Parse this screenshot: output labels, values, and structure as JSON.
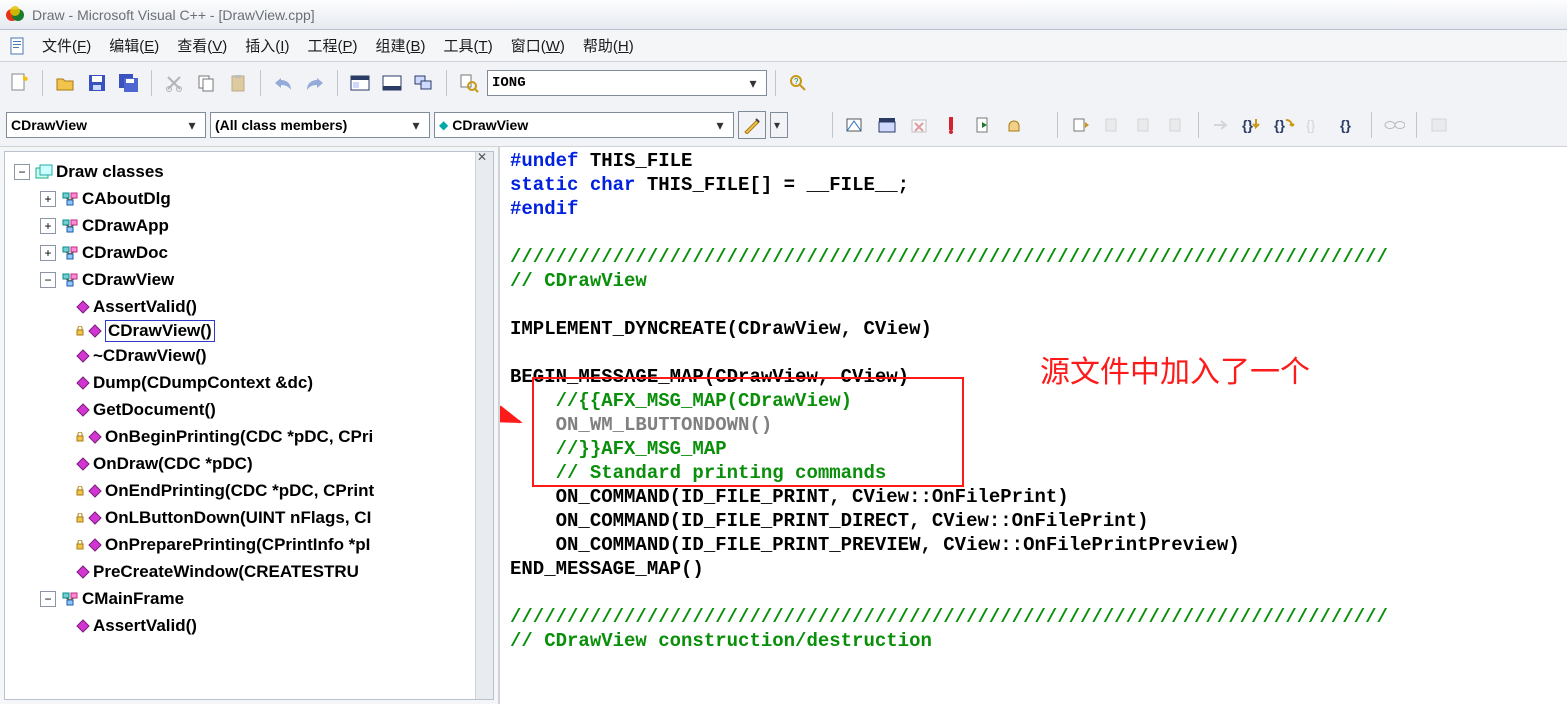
{
  "title": "Draw - Microsoft Visual C++ - [DrawView.cpp]",
  "menus": {
    "file": {
      "t": "文件",
      "k": "F"
    },
    "edit": {
      "t": "编辑",
      "k": "E"
    },
    "view": {
      "t": "查看",
      "k": "V"
    },
    "insert": {
      "t": "插入",
      "k": "I"
    },
    "project": {
      "t": "工程",
      "k": "P"
    },
    "build": {
      "t": "组建",
      "k": "B"
    },
    "tools": {
      "t": "工具",
      "k": "T"
    },
    "window": {
      "t": "窗口",
      "k": "W"
    },
    "help": {
      "t": "帮助",
      "k": "H"
    }
  },
  "toolbar1": {
    "search_value": "IONG"
  },
  "combos": {
    "class": "CDrawView",
    "filter": "(All class members)",
    "member": "CDrawView"
  },
  "tree": {
    "root": "Draw classes",
    "classes": [
      {
        "name": "CAboutDlg",
        "exp": "+"
      },
      {
        "name": "CDrawApp",
        "exp": "+"
      },
      {
        "name": "CDrawDoc",
        "exp": "+"
      },
      {
        "name": "CDrawView",
        "exp": "-",
        "members": [
          {
            "icon": "pub",
            "label": "AssertValid()"
          },
          {
            "icon": "prot",
            "label": "CDrawView()",
            "selected": true
          },
          {
            "icon": "pub",
            "label": "~CDrawView()"
          },
          {
            "icon": "pub",
            "label": "Dump(CDumpContext &dc)"
          },
          {
            "icon": "pub",
            "label": "GetDocument()"
          },
          {
            "icon": "prot",
            "label": "OnBeginPrinting(CDC *pDC, CPri"
          },
          {
            "icon": "pub",
            "label": "OnDraw(CDC *pDC)"
          },
          {
            "icon": "prot",
            "label": "OnEndPrinting(CDC *pDC, CPrint"
          },
          {
            "icon": "prot",
            "label": "OnLButtonDown(UINT nFlags, CI"
          },
          {
            "icon": "prot",
            "label": "OnPreparePrinting(CPrintInfo *pI"
          },
          {
            "icon": "pub",
            "label": "PreCreateWindow(CREATESTRU"
          }
        ]
      },
      {
        "name": "CMainFrame",
        "exp": "-",
        "members": [
          {
            "icon": "pub",
            "label": "AssertValid()"
          }
        ]
      }
    ]
  },
  "code_lines": [
    {
      "segments": [
        {
          "c": "kw",
          "t": "#undef"
        },
        {
          "c": "",
          "t": " THIS_FILE"
        }
      ]
    },
    {
      "segments": [
        {
          "c": "kw",
          "t": "static"
        },
        {
          "c": "",
          "t": " "
        },
        {
          "c": "kw",
          "t": "char"
        },
        {
          "c": "",
          "t": " THIS_FILE[] = __FILE__;"
        }
      ]
    },
    {
      "segments": [
        {
          "c": "kw",
          "t": "#endif"
        }
      ]
    },
    {
      "segments": [
        {
          "c": "",
          "t": ""
        }
      ]
    },
    {
      "segments": [
        {
          "c": "cm",
          "t": "/////////////////////////////////////////////////////////////////////////////"
        }
      ]
    },
    {
      "segments": [
        {
          "c": "cm",
          "t": "// CDrawView"
        }
      ]
    },
    {
      "segments": [
        {
          "c": "",
          "t": ""
        }
      ]
    },
    {
      "segments": [
        {
          "c": "",
          "t": "IMPLEMENT_DYNCREATE(CDrawView, CView)"
        }
      ]
    },
    {
      "segments": [
        {
          "c": "",
          "t": ""
        }
      ]
    },
    {
      "segments": [
        {
          "c": "",
          "t": "BEGIN_MESSAGE_MAP(CDrawView, CView)"
        }
      ]
    },
    {
      "segments": [
        {
          "c": "",
          "t": "    "
        },
        {
          "c": "cm",
          "t": "//{{AFX_MSG_MAP(CDrawView)"
        }
      ]
    },
    {
      "segments": [
        {
          "c": "",
          "t": "    "
        },
        {
          "c": "gray",
          "t": "ON_WM_LBUTTONDOWN()"
        }
      ]
    },
    {
      "segments": [
        {
          "c": "",
          "t": "    "
        },
        {
          "c": "cm",
          "t": "//}}AFX_MSG_MAP"
        }
      ]
    },
    {
      "segments": [
        {
          "c": "",
          "t": "    "
        },
        {
          "c": "cm",
          "t": "// Standard printing commands"
        }
      ]
    },
    {
      "segments": [
        {
          "c": "",
          "t": "    ON_COMMAND(ID_FILE_PRINT, CView::OnFilePrint)"
        }
      ]
    },
    {
      "segments": [
        {
          "c": "",
          "t": "    ON_COMMAND(ID_FILE_PRINT_DIRECT, CView::OnFilePrint)"
        }
      ]
    },
    {
      "segments": [
        {
          "c": "",
          "t": "    ON_COMMAND(ID_FILE_PRINT_PREVIEW, CView::OnFilePrintPreview)"
        }
      ]
    },
    {
      "segments": [
        {
          "c": "",
          "t": "END_MESSAGE_MAP()"
        }
      ]
    },
    {
      "segments": [
        {
          "c": "",
          "t": ""
        }
      ]
    },
    {
      "segments": [
        {
          "c": "cm",
          "t": "/////////////////////////////////////////////////////////////////////////////"
        }
      ]
    },
    {
      "segments": [
        {
          "c": "cm",
          "t": "// CDrawView construction/destruction"
        }
      ]
    }
  ],
  "annotation": "源文件中加入了一个"
}
